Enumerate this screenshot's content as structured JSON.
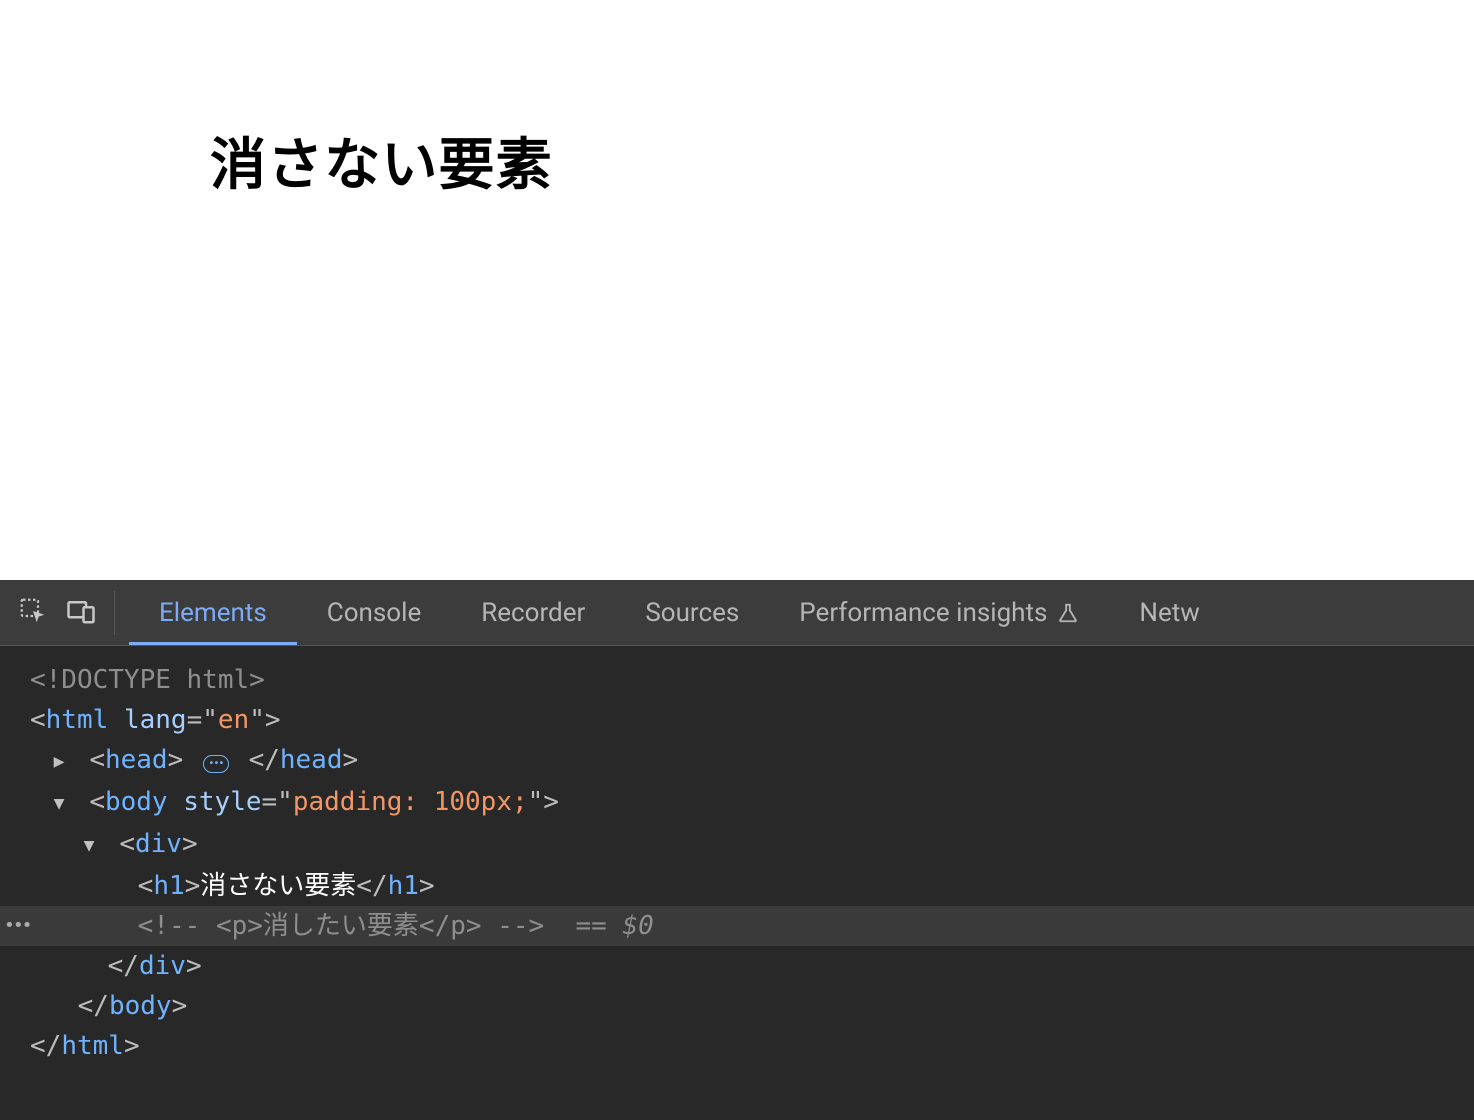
{
  "page": {
    "heading": "消さない要素"
  },
  "devtools": {
    "tabs": [
      "Elements",
      "Console",
      "Recorder",
      "Sources",
      "Performance insights",
      "Netw"
    ],
    "active_tab_index": 0,
    "dom": {
      "doctype": "<!DOCTYPE html>",
      "html_open": {
        "tag": "html",
        "attr_name": "lang",
        "attr_val": "en"
      },
      "head": {
        "tag": "head"
      },
      "body_open": {
        "tag": "body",
        "attr_name": "style",
        "attr_val": "padding: 100px;"
      },
      "div_open": {
        "tag": "div"
      },
      "h1_line": {
        "tag": "h1",
        "text": "消さない要素"
      },
      "comment_line": {
        "raw": "<!-- <p>消したい要素</p> -->",
        "text": "消したい要素"
      },
      "eq0": "== $0",
      "div_close": {
        "tag": "div"
      },
      "body_close": {
        "tag": "body"
      },
      "html_close": {
        "tag": "html"
      }
    }
  }
}
